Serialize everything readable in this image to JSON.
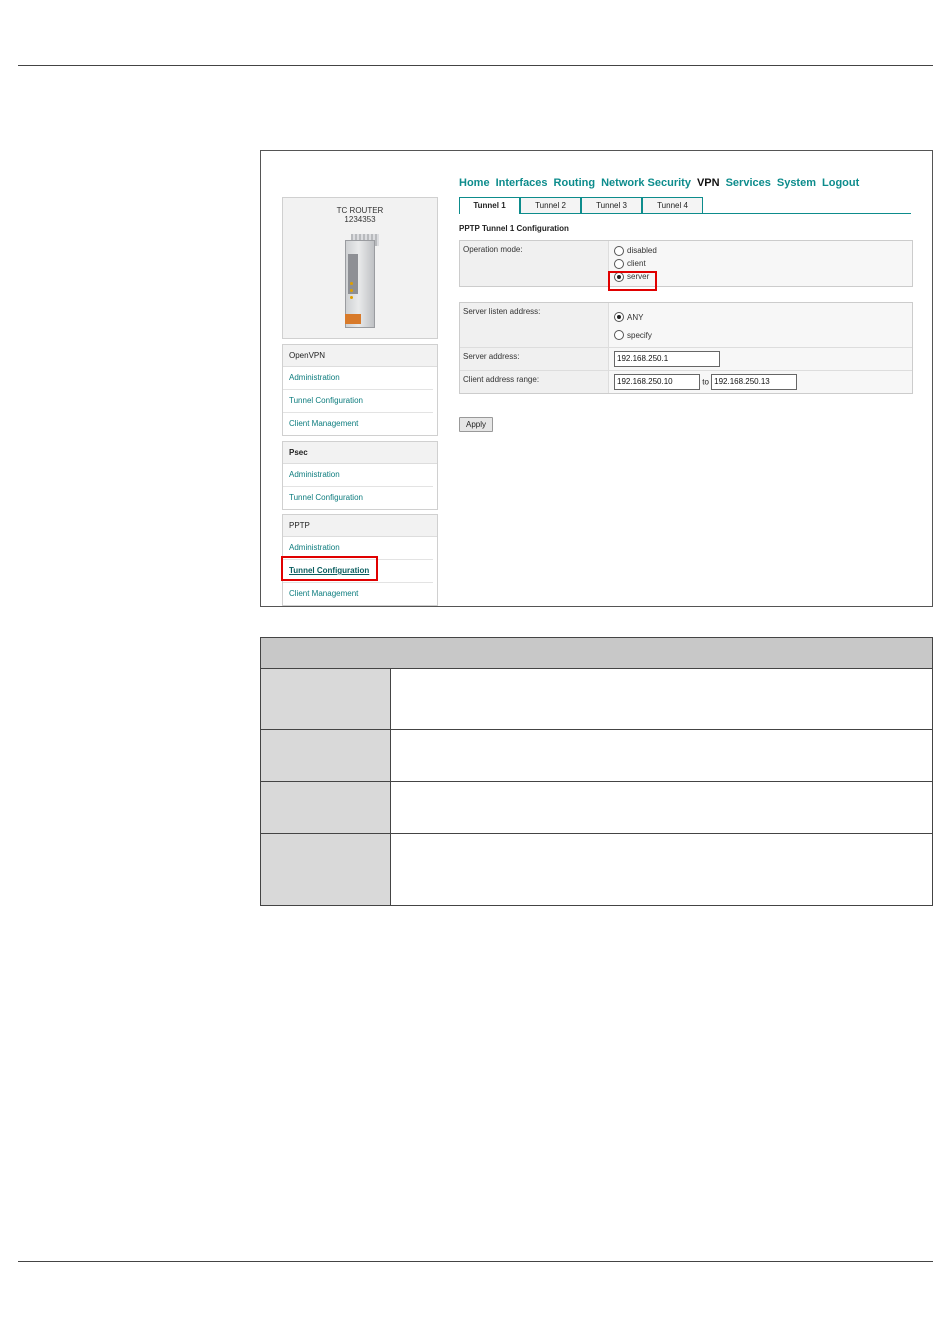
{
  "device": {
    "name": "TC ROUTER",
    "number": "1234353"
  },
  "nav": [
    "Home",
    "Interfaces",
    "Routing",
    "Network Security",
    "VPN",
    "Services",
    "System",
    "Logout"
  ],
  "nav_active": "VPN",
  "tabs": [
    "Tunnel 1",
    "Tunnel 2",
    "Tunnel 3",
    "Tunnel 4"
  ],
  "section_title": "PPTP Tunnel 1 Configuration",
  "menus": {
    "openvpn": {
      "head": "OpenVPN",
      "items": [
        "Administration",
        "Tunnel Configuration",
        "Client Management"
      ]
    },
    "ipsec": {
      "head": "Psec",
      "items": [
        "Administration",
        "Tunnel Configuration"
      ]
    },
    "pptp": {
      "head": "PPTP",
      "items": [
        "Administration",
        "Tunnel Configuration",
        "Client Management"
      ]
    }
  },
  "operation_mode": {
    "label": "Operation mode:",
    "options": [
      "disabled",
      "client",
      "server"
    ],
    "selected": "server"
  },
  "server_listen": {
    "label": "Server listen address:",
    "options": [
      "ANY",
      "specify"
    ],
    "selected": "ANY"
  },
  "server_address": {
    "label": "Server address:",
    "value": "192.168.250.1"
  },
  "client_range": {
    "label": "Client address range:",
    "from": "192.168.250.10",
    "to_label": "to",
    "to": "192.168.250.13"
  },
  "apply_label": "Apply",
  "colors": {
    "link": "#0d8c8c",
    "highlight": "#e00000"
  }
}
